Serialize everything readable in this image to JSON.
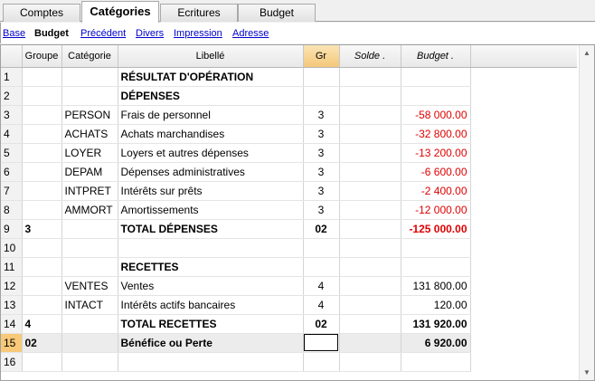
{
  "tabs": [
    {
      "label": "Comptes"
    },
    {
      "label": "Catégories"
    },
    {
      "label": "Ecritures"
    },
    {
      "label": "Budget"
    }
  ],
  "views": [
    {
      "label": "Base"
    },
    {
      "label": "Budget"
    },
    {
      "label": "Précédent"
    },
    {
      "label": "Divers"
    },
    {
      "label": "Impression"
    },
    {
      "label": "Adresse"
    }
  ],
  "columns": {
    "groupe": "Groupe",
    "categorie": "Catégorie",
    "libelle": "Libellé",
    "gr": "Gr",
    "solde": "Solde .",
    "budget": "Budget ."
  },
  "rows": [
    {
      "n": "1",
      "groupe": "",
      "categorie": "",
      "libelle": "RÉSULTAT D'OPÉRATION",
      "gr": "",
      "solde": "",
      "budget": ""
    },
    {
      "n": "2",
      "groupe": "",
      "categorie": "",
      "libelle": "DÉPENSES",
      "gr": "",
      "solde": "",
      "budget": ""
    },
    {
      "n": "3",
      "groupe": "",
      "categorie": "PERSON",
      "libelle": "Frais de personnel",
      "gr": "3",
      "solde": "",
      "budget": "-58 000.00"
    },
    {
      "n": "4",
      "groupe": "",
      "categorie": "ACHATS",
      "libelle": "Achats marchandises",
      "gr": "3",
      "solde": "",
      "budget": "-32 800.00"
    },
    {
      "n": "5",
      "groupe": "",
      "categorie": "LOYER",
      "libelle": "Loyers et autres dépenses",
      "gr": "3",
      "solde": "",
      "budget": "-13 200.00"
    },
    {
      "n": "6",
      "groupe": "",
      "categorie": "DEPAM",
      "libelle": "Dépenses administratives",
      "gr": "3",
      "solde": "",
      "budget": "-6 600.00"
    },
    {
      "n": "7",
      "groupe": "",
      "categorie": "INTPRET",
      "libelle": "Intérêts sur prêts",
      "gr": "3",
      "solde": "",
      "budget": "-2 400.00"
    },
    {
      "n": "8",
      "groupe": "",
      "categorie": "AMMORT",
      "libelle": "Amortissements",
      "gr": "3",
      "solde": "",
      "budget": "-12 000.00"
    },
    {
      "n": "9",
      "groupe": "3",
      "categorie": "",
      "libelle": "TOTAL DÉPENSES",
      "gr": "02",
      "solde": "",
      "budget": "-125 000.00"
    },
    {
      "n": "10",
      "groupe": "",
      "categorie": "",
      "libelle": "",
      "gr": "",
      "solde": "",
      "budget": ""
    },
    {
      "n": "11",
      "groupe": "",
      "categorie": "",
      "libelle": "RECETTES",
      "gr": "",
      "solde": "",
      "budget": ""
    },
    {
      "n": "12",
      "groupe": "",
      "categorie": "VENTES",
      "libelle": "Ventes",
      "gr": "4",
      "solde": "",
      "budget": "131 800.00"
    },
    {
      "n": "13",
      "groupe": "",
      "categorie": "INTACT",
      "libelle": "Intérêts actifs bancaires",
      "gr": "4",
      "solde": "",
      "budget": "120.00"
    },
    {
      "n": "14",
      "groupe": "4",
      "categorie": "",
      "libelle": "TOTAL RECETTES",
      "gr": "02",
      "solde": "",
      "budget": "131 920.00"
    },
    {
      "n": "15",
      "groupe": "02",
      "categorie": "",
      "libelle": "Bénéfice ou Perte",
      "gr": "",
      "solde": "",
      "budget": "6 920.00"
    },
    {
      "n": "16",
      "groupe": "",
      "categorie": "",
      "libelle": "",
      "gr": "",
      "solde": "",
      "budget": ""
    }
  ],
  "colors": {
    "negative": "#e00000",
    "link": "#0000cc",
    "current_row": "#f7c978"
  }
}
